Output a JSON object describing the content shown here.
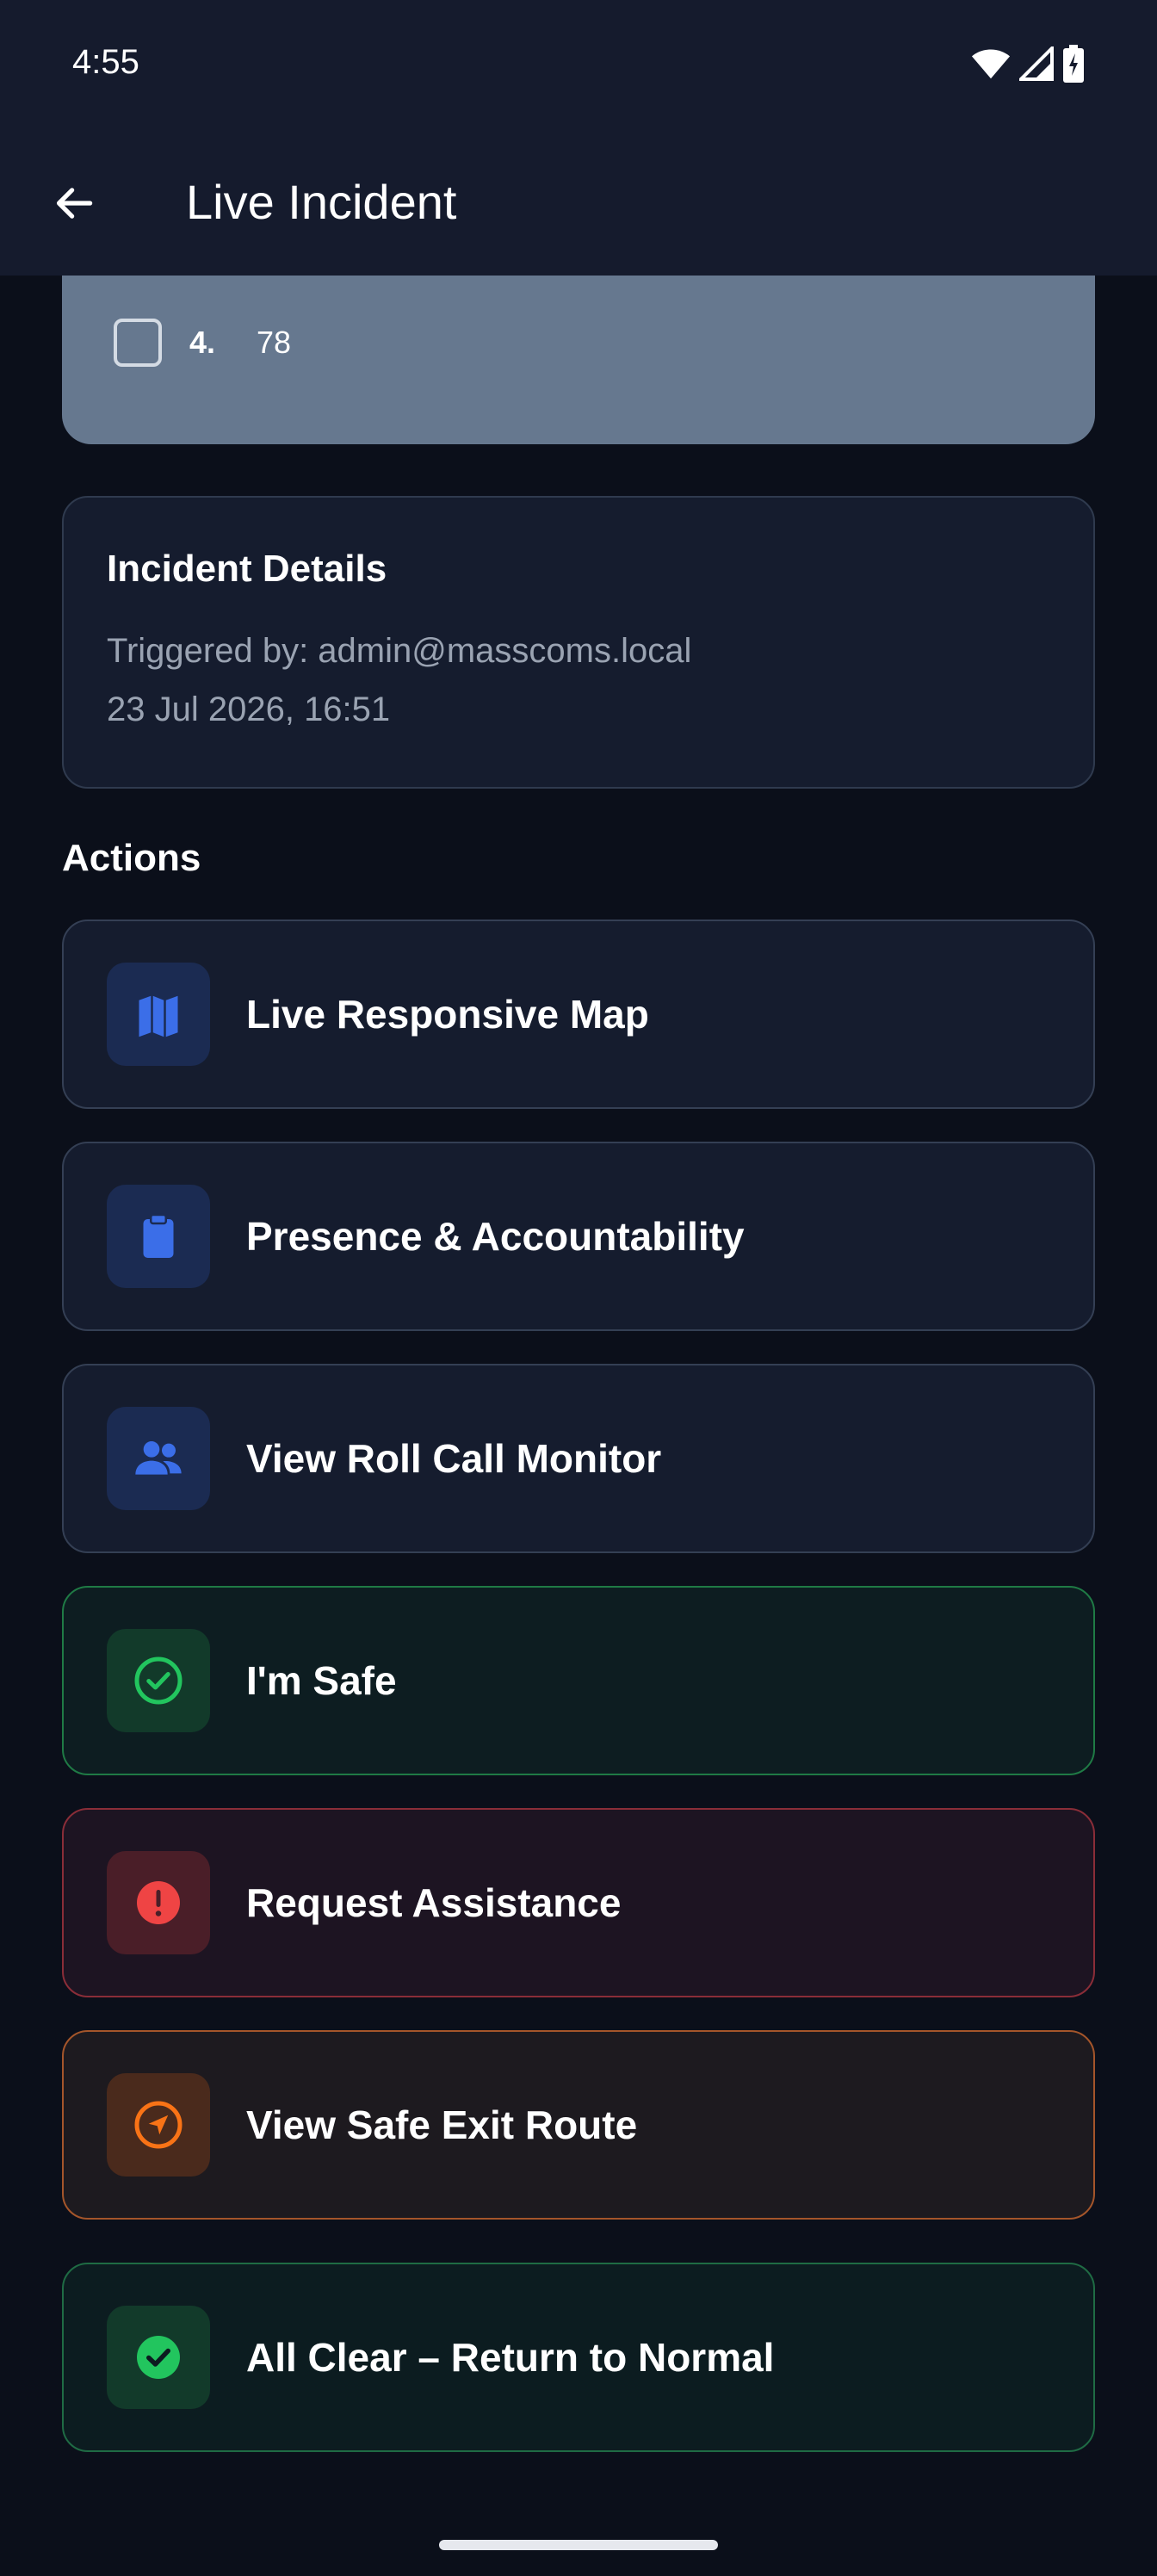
{
  "status_bar": {
    "time": "4:55",
    "icons": [
      "wifi-icon",
      "signal-icon",
      "battery-charging-icon"
    ]
  },
  "app_bar": {
    "back_icon": "arrow-left-icon",
    "title": "Live Incident"
  },
  "checklist": {
    "items": [
      {
        "number": "",
        "text": ""
      },
      {
        "number": "4.",
        "text": "78"
      }
    ]
  },
  "incident_details": {
    "title": "Incident Details",
    "triggered_by": "Triggered by: admin@masscoms.local",
    "timestamp": "23 Jul 2026, 16:51"
  },
  "actions": {
    "heading": "Actions",
    "items": [
      {
        "label": "Live Responsive Map",
        "icon": "map-icon",
        "accent": "#3b6ee8"
      },
      {
        "label": "Presence & Accountability",
        "icon": "clipboard-icon",
        "accent": "#3b6ee8"
      },
      {
        "label": "View Roll Call Monitor",
        "icon": "people-icon",
        "accent": "#3b6ee8"
      },
      {
        "label": "I'm Safe",
        "icon": "check-circle-outline-icon",
        "accent": "#22c55e"
      },
      {
        "label": "Request Assistance",
        "icon": "alert-circle-icon",
        "accent": "#ef4444"
      },
      {
        "label": "View Safe Exit Route",
        "icon": "navigation-arrow-icon",
        "accent": "#f97316"
      },
      {
        "label": "All Clear – Return to Normal",
        "icon": "check-circle-filled-icon",
        "accent": "#22c55e"
      }
    ]
  },
  "colors": {
    "background": "#0b0f1a",
    "app_bar": "#151b2d",
    "card": "#151c2e",
    "checklist_card": "#66788f",
    "muted_text": "#9aa3b2"
  }
}
